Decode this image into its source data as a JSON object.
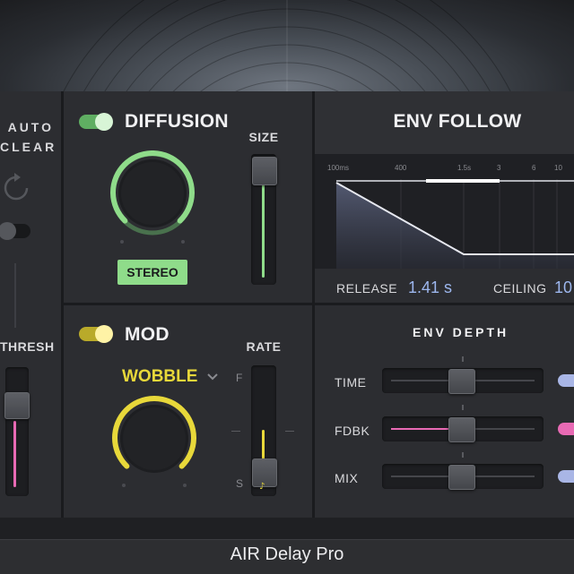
{
  "window": {
    "title": "AIR Delay Pro"
  },
  "auto_clear": {
    "label_line1": "AUTO",
    "label_line2": "CLEAR",
    "thresh_label": "THRESH"
  },
  "diffusion": {
    "title": "DIFFUSION",
    "enabled": true,
    "mode_button": "STEREO",
    "size_label": "SIZE",
    "accent": "#8fdc8a"
  },
  "mod": {
    "title": "MOD",
    "enabled": true,
    "shape": "WOBBLE",
    "rate_label": "RATE",
    "rate_fast": "F",
    "rate_slow": "S",
    "rate_sync": "♪",
    "accent": "#e8d83a"
  },
  "env_follow": {
    "title": "ENV FOLLOW",
    "time_ticks": [
      "100ms",
      "400",
      "1.5s",
      "3",
      "6",
      "10"
    ],
    "release_label": "RELEASE",
    "release_value": "1.41 s",
    "ceiling_label": "CEILING",
    "ceiling_value": "10"
  },
  "env_depth": {
    "title": "ENV DEPTH",
    "rows": [
      {
        "label": "TIME",
        "color": "#a9b6e6"
      },
      {
        "label": "FDBK",
        "color": "#e86ab4"
      },
      {
        "label": "MIX",
        "color": "#a9b6e6"
      }
    ]
  },
  "colors": {
    "green": "#8fdc8a",
    "yellow": "#e8d83a",
    "pink": "#e86ab4",
    "value_blue": "#9db7ee"
  }
}
